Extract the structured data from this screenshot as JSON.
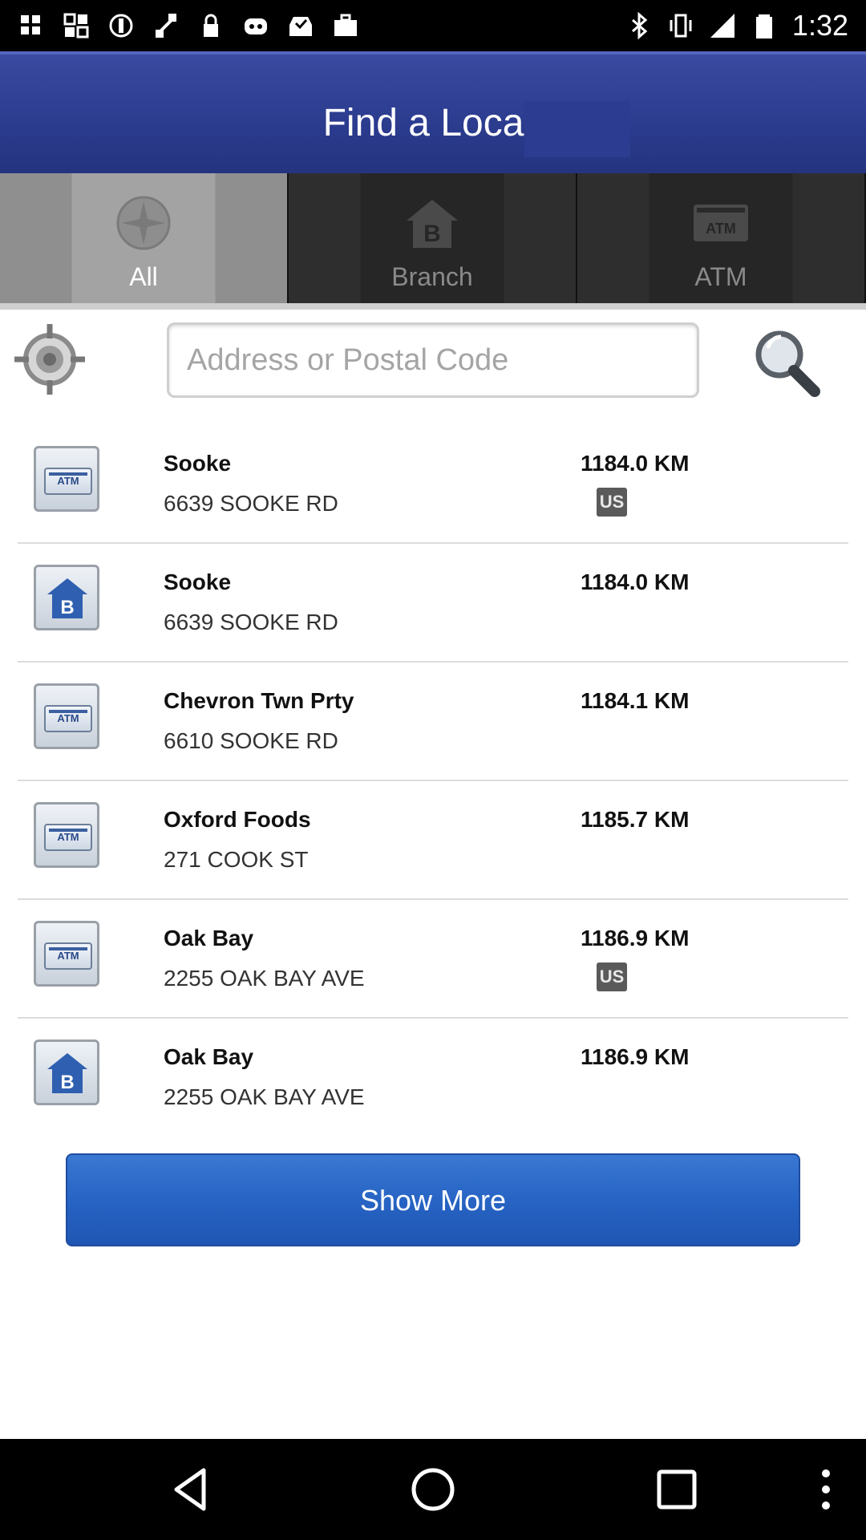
{
  "status_bar": {
    "time": "1:32",
    "icons": [
      "app-icon-1",
      "app-icon-2",
      "app-icon-3",
      "fake-gps-icon",
      "lock-icon",
      "app-icon-4",
      "inbox-icon",
      "briefcase-icon",
      "bluetooth-icon",
      "vibrate-icon",
      "signal-icon",
      "battery-icon"
    ]
  },
  "header": {
    "title": "Find a Locati"
  },
  "tabs": [
    {
      "label": "All",
      "icon": "compass-icon",
      "active": true
    },
    {
      "label": "Branch",
      "icon": "bank-icon",
      "active": false
    },
    {
      "label": "ATM",
      "icon": "atm-icon",
      "active": false
    }
  ],
  "search": {
    "placeholder": "Address or Postal Code",
    "value": ""
  },
  "locations": [
    {
      "type": "atm",
      "name": "Sooke",
      "address": "6639 SOOKE RD",
      "distance": "1184.0 KM",
      "badge": "US"
    },
    {
      "type": "branch",
      "name": "Sooke",
      "address": "6639 SOOKE RD",
      "distance": "1184.0 KM",
      "badge": ""
    },
    {
      "type": "atm",
      "name": "Chevron Twn Prty",
      "address": "6610 SOOKE RD",
      "distance": "1184.1 KM",
      "badge": ""
    },
    {
      "type": "atm",
      "name": "Oxford Foods",
      "address": "271 COOK ST",
      "distance": "1185.7 KM",
      "badge": ""
    },
    {
      "type": "atm",
      "name": "Oak Bay",
      "address": "2255 OAK BAY AVE",
      "distance": "1186.9 KM",
      "badge": "US"
    },
    {
      "type": "branch",
      "name": "Oak Bay",
      "address": "2255 OAK BAY AVE",
      "distance": "1186.9 KM",
      "badge": ""
    }
  ],
  "show_more_label": "Show More",
  "nav": [
    "back-icon",
    "home-icon",
    "recents-icon",
    "menu-icon"
  ]
}
